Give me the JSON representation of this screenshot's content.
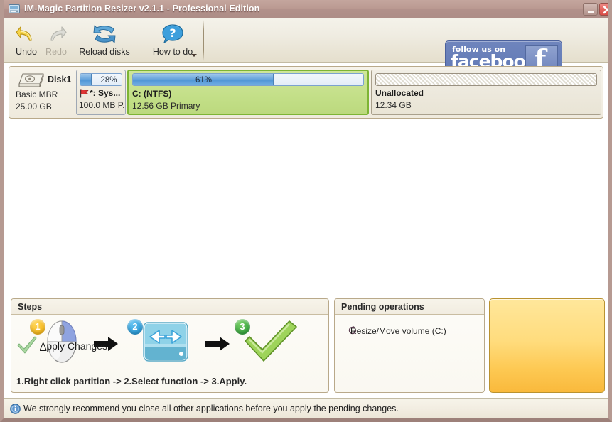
{
  "window": {
    "title": "IM-Magic Partition Resizer v2.1.1 - Professional Edition",
    "app_icon": "disk-app-icon",
    "minimize_label": "Minimize",
    "close_label": "Close"
  },
  "toolbar": {
    "buttons": [
      {
        "label": "Undo",
        "icon": "undo-arrow-icon",
        "enabled": true
      },
      {
        "label": "Redo",
        "icon": "redo-arrow-icon",
        "enabled": false
      },
      {
        "label": "Reload disks",
        "icon": "reload-disks-icon",
        "enabled": true
      },
      {
        "label": "How to do",
        "icon": "help-question-icon",
        "enabled": true
      }
    ],
    "dropdown_icon": "chevron-down-icon"
  },
  "promo": {
    "follow_text": "follow us on",
    "brand": "facebook",
    "glyph": "f"
  },
  "disk": {
    "name": "Disk1",
    "type": "Basic MBR",
    "size": "25.00 GB",
    "icon": "hard-disk-icon"
  },
  "partitions": [
    {
      "key": "system",
      "label": "*: Sys...",
      "sub": "100.0 MB P.",
      "usage_percent": 28,
      "usage_text": "28%",
      "flag_icon": "red-flag-icon",
      "selected": false,
      "unallocated": false
    },
    {
      "key": "c-drive",
      "label": "C: (NTFS)",
      "sub": "12.56 GB Primary",
      "usage_percent": 61,
      "usage_text": "61%",
      "selected": true,
      "unallocated": false
    },
    {
      "key": "unallocated",
      "label": "Unallocated",
      "sub": "12.34 GB",
      "usage_percent": 0,
      "usage_text": "",
      "selected": false,
      "unallocated": true
    }
  ],
  "steps_panel": {
    "title": "Steps",
    "badges": [
      "1",
      "2",
      "3"
    ],
    "icons": [
      "mouse-right-click-icon",
      "resize-volume-icon",
      "green-check-icon"
    ],
    "caption": "1.Right click partition -> 2.Select function -> 3.Apply."
  },
  "pending_panel": {
    "title": "Pending operations",
    "items": [
      {
        "text": "Resize/Move volume (C:)",
        "icon": "refresh-circle-icon"
      }
    ]
  },
  "apply_button": {
    "label_accel": "A",
    "label_rest": "pply Changes",
    "icon": "green-check-icon"
  },
  "statusbar": {
    "icon": "info-icon",
    "text": "We strongly recommend you close all other applications before you apply the pending changes."
  },
  "colors": {
    "titlebar": "#bb9a92",
    "toolbar": "#efece1",
    "selection_green": "#7db434",
    "partition_green": "#c3df88",
    "usage_blue": "#4f95d6",
    "apply_yellow": "#fdc953",
    "facebook_blue": "#5f77b4"
  }
}
